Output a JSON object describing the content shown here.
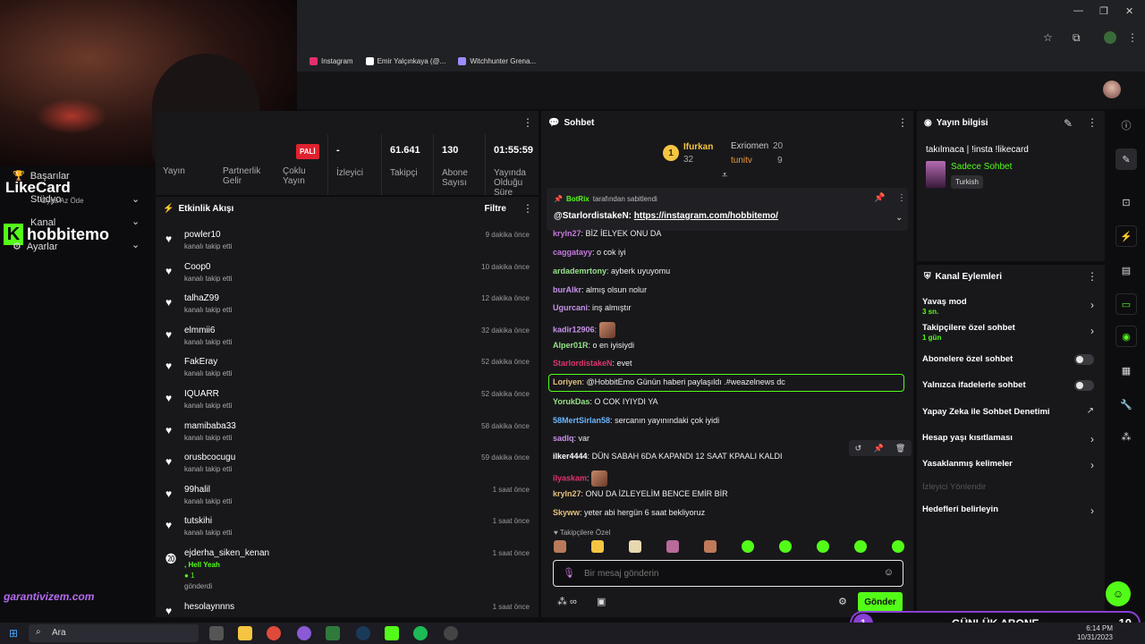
{
  "browser": {
    "bookmarks": [
      {
        "label": "Instagram",
        "icon": "instagram-icon",
        "color": "#e1306c"
      },
      {
        "label": "Emir Yalçınkaya (@...",
        "icon": "x-icon",
        "color": "#ffffff"
      },
      {
        "label": "Witchhunter Grena...",
        "icon": "shield-icon",
        "color": "#9b8cff"
      }
    ]
  },
  "sidebar": {
    "basarilar": "Başarılar",
    "studyo": "Stüdyo",
    "kanal": "Kanal",
    "ayarlar": "Ayarlar",
    "likecard": "LikeCard",
    "likecard_sub": "Oyna  Az Öde",
    "hobbit": "hobbitemo",
    "garanti": "garantivizem.com"
  },
  "stats": {
    "badge": "PALİ",
    "items": [
      {
        "value": "",
        "label": "Yayın"
      },
      {
        "value": "",
        "label": "Partnerlik Gelir"
      },
      {
        "value": "",
        "label": "Çoklu Yayın"
      },
      {
        "value": "-",
        "label": "İzleyici"
      },
      {
        "value": "61.641",
        "label": "Takipçi"
      },
      {
        "value": "130",
        "label": "Abone Sayısı"
      },
      {
        "value": "01:55:59",
        "label": "Yayında Olduğu Süre"
      }
    ]
  },
  "activity": {
    "title": "Etkinlik Akışı",
    "filter": "Filtre",
    "rows": [
      {
        "user": "powler10",
        "desc": "kanalı takip etti",
        "time": "9 dakika önce"
      },
      {
        "user": "Coop0",
        "desc": "kanalı takip etti",
        "time": "10 dakika önce"
      },
      {
        "user": "talhaZ99",
        "desc": "kanalı takip etti",
        "time": "12 dakika önce"
      },
      {
        "user": "elmmii6",
        "desc": "kanalı takip etti",
        "time": "32 dakika önce"
      },
      {
        "user": "FakEray",
        "desc": "kanalı takip etti",
        "time": "52 dakika önce"
      },
      {
        "user": "IQUARR",
        "desc": "kanalı takip etti",
        "time": "52 dakika önce"
      },
      {
        "user": "mamibaba33",
        "desc": "kanalı takip etti",
        "time": "58 dakika önce"
      },
      {
        "user": "orusbcocugu",
        "desc": "kanalı takip etti",
        "time": "59 dakika önce"
      },
      {
        "user": "99halil",
        "desc": "kanalı takip etti",
        "time": "1 saat önce"
      },
      {
        "user": "tutskihi",
        "desc": "kanalı takip etti",
        "time": "1 saat önce"
      },
      {
        "user": "ejderha_siken_kenan",
        "desc": ", Hell Yeah",
        "time": "1 saat önce",
        "extra1": "1",
        "extra2": "gönderdi"
      },
      {
        "user": "hesolaynnns",
        "desc": "",
        "time": "1 saat önce"
      }
    ]
  },
  "chat": {
    "title": "Sohbet",
    "leaderboard": {
      "first": {
        "rank": "1",
        "name": "Ifurkan",
        "count": "32"
      },
      "second": {
        "name": "Exriomen",
        "count": "20"
      },
      "third": {
        "name": "tunitv",
        "count": "9"
      }
    },
    "pinned": {
      "by": "BotRix",
      "by_suffix": "tarafından sabitlendi",
      "author": "@StarlordistakeN",
      "link": "https://instagram.com/hobbitemo/"
    },
    "messages": [
      {
        "user": "kryln27",
        "color": "#c678dd",
        "text": "BİZ İELYEK ONU DA"
      },
      {
        "user": "caggatayy",
        "color": "#c678dd",
        "text": "o cok iyi"
      },
      {
        "user": "ardademrtony",
        "color": "#98e28a",
        "text": "ayberk uyuyomu"
      },
      {
        "user": "burAlkr",
        "color": "#c792ea",
        "text": "almış olsun nolur"
      },
      {
        "user": "Ugurcani",
        "color": "#c792ea",
        "text": "inş almıştır"
      },
      {
        "user": "kadir12906",
        "color": "#c792ea",
        "text": ""
      },
      {
        "user": "Alper01R",
        "color": "#98e28a",
        "text": "o en iyisiydi"
      },
      {
        "user": "StarlordistakeN",
        "color": "#e0356c",
        "text": "evet"
      },
      {
        "user": "Loriyen",
        "color": "#e5c07b",
        "text": "@HobbitEmo Günün haberi paylaşıldı .#weazelnews dc"
      },
      {
        "user": "YorukDas",
        "color": "#98e28a",
        "text": "O COK IYIYDI YA"
      },
      {
        "user": "58MertSirlan58",
        "color": "#6cb6ff",
        "text": "sercanın yayınındaki çok iyidi"
      },
      {
        "user": "sadlq",
        "color": "#c792ea",
        "text": "var"
      },
      {
        "user": "ilker4444",
        "color": "#ffffff",
        "text": "DÜN SABAH 6DA KAPANDI 12 SAAT KPAALI KALDI"
      },
      {
        "user": "ilyaskam",
        "color": "#e0356c",
        "text": ""
      },
      {
        "user": "kryln27",
        "color": "#e5c07b",
        "text": "ONU DA İZLEYELİM BENCE EMİR BİR"
      },
      {
        "user": "Skyww",
        "color": "#e5c07b",
        "text": "yeter abi hergün 6 saat bekliyoruz"
      }
    ],
    "follower_only": "Takipçilere Özel",
    "input_placeholder": "Bir mesaj gönderin",
    "send": "Gönder"
  },
  "info": {
    "title": "Yayın bilgisi",
    "stream_title": "takılmaca | !insta !likecard",
    "category": "Sadece Sohbet",
    "language": "Turkish"
  },
  "actions": {
    "title": "Kanal Eylemleri",
    "items": [
      {
        "label": "Yavaş mod",
        "sub": "3 sn."
      },
      {
        "label": "Takipçilere özel sohbet",
        "sub": "1 gün"
      },
      {
        "label": "Abonelere özel sohbet"
      },
      {
        "label": "Yalnızca ifadelerle sohbet"
      },
      {
        "label": "Yapay Zeka ile Sohbet Denetimi"
      },
      {
        "label": "Hesap yaşı kısıtlaması"
      },
      {
        "label": "Yasaklanmış kelimeler"
      },
      {
        "label": "İzleyici Yönlendir"
      },
      {
        "label": "Hedefleri belirleyin"
      }
    ]
  },
  "banner": {
    "left": "1",
    "title": "GÜNLÜK ABONE",
    "right": "10"
  },
  "taskbar": {
    "search": "Ara",
    "time": "6:14 PM",
    "date": "10/31/2023"
  },
  "colors": {
    "accent": "#53fc18",
    "panel": "#18181b",
    "purple": "#8a3fd6"
  }
}
